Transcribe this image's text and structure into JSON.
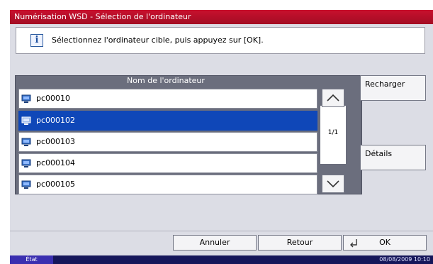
{
  "window": {
    "title": "Numérisation WSD - Sélection de l'ordinateur"
  },
  "info": {
    "message": "Sélectionnez l'ordinateur cible, puis appuyez sur [OK]."
  },
  "list": {
    "header": "Nom de l'ordinateur",
    "rows": [
      {
        "label": "pc00010",
        "selected": false
      },
      {
        "label": "pc000102",
        "selected": true
      },
      {
        "label": "pc000103",
        "selected": false
      },
      {
        "label": "pc000104",
        "selected": false
      },
      {
        "label": "pc000105",
        "selected": false
      }
    ],
    "page_indicator": "1/1"
  },
  "side": {
    "reload_label": "Recharger",
    "details_label": "Détails"
  },
  "bottom": {
    "cancel_label": "Annuler",
    "back_label": "Retour",
    "ok_label": "OK"
  },
  "status": {
    "state_label": "État",
    "datetime": "08/08/2009   10:10"
  },
  "colors": {
    "title_bar": "#c8102e",
    "selected_row": "#0f47b8",
    "status_bar": "#15165a",
    "status_state": "#3a2fb0"
  }
}
